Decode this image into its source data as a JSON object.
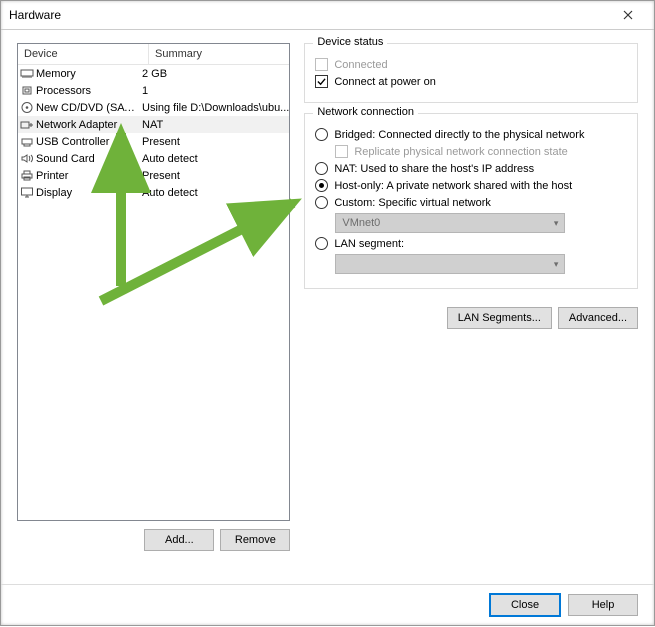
{
  "title": "Hardware",
  "columns": {
    "device": "Device",
    "summary": "Summary"
  },
  "devices": [
    {
      "icon": "memory-icon",
      "name": "Memory",
      "summary": "2 GB",
      "selected": false
    },
    {
      "icon": "cpu-icon",
      "name": "Processors",
      "summary": "1",
      "selected": false
    },
    {
      "icon": "disc-icon",
      "name": "New CD/DVD (SATA)",
      "summary": "Using file D:\\Downloads\\ubu...",
      "selected": false
    },
    {
      "icon": "nic-icon",
      "name": "Network Adapter",
      "summary": "NAT",
      "selected": true
    },
    {
      "icon": "usb-icon",
      "name": "USB Controller",
      "summary": "Present",
      "selected": false
    },
    {
      "icon": "sound-icon",
      "name": "Sound Card",
      "summary": "Auto detect",
      "selected": false
    },
    {
      "icon": "printer-icon",
      "name": "Printer",
      "summary": "Present",
      "selected": false
    },
    {
      "icon": "display-icon",
      "name": "Display",
      "summary": "Auto detect",
      "selected": false
    }
  ],
  "buttons": {
    "add": "Add...",
    "remove": "Remove",
    "lan_segments": "LAN Segments...",
    "advanced": "Advanced...",
    "close": "Close",
    "help": "Help"
  },
  "device_status": {
    "legend": "Device status",
    "connected": {
      "label": "Connected",
      "checked": false,
      "disabled": true
    },
    "connect_power": {
      "label": "Connect at power on",
      "checked": true
    }
  },
  "net_conn": {
    "legend": "Network connection",
    "bridged": {
      "label": "Bridged: Connected directly to the physical network",
      "checked": false
    },
    "replicate": {
      "label": "Replicate physical network connection state",
      "disabled": true
    },
    "nat": {
      "label": "NAT: Used to share the host's IP address",
      "checked": false
    },
    "hostonly": {
      "label": "Host-only: A private network shared with the host",
      "checked": true
    },
    "custom": {
      "label": "Custom: Specific virtual network",
      "checked": false
    },
    "custom_combo": {
      "value": "VMnet0",
      "disabled": true
    },
    "lan": {
      "label": "LAN segment:",
      "checked": false
    },
    "lan_combo": {
      "value": "",
      "disabled": true
    }
  }
}
